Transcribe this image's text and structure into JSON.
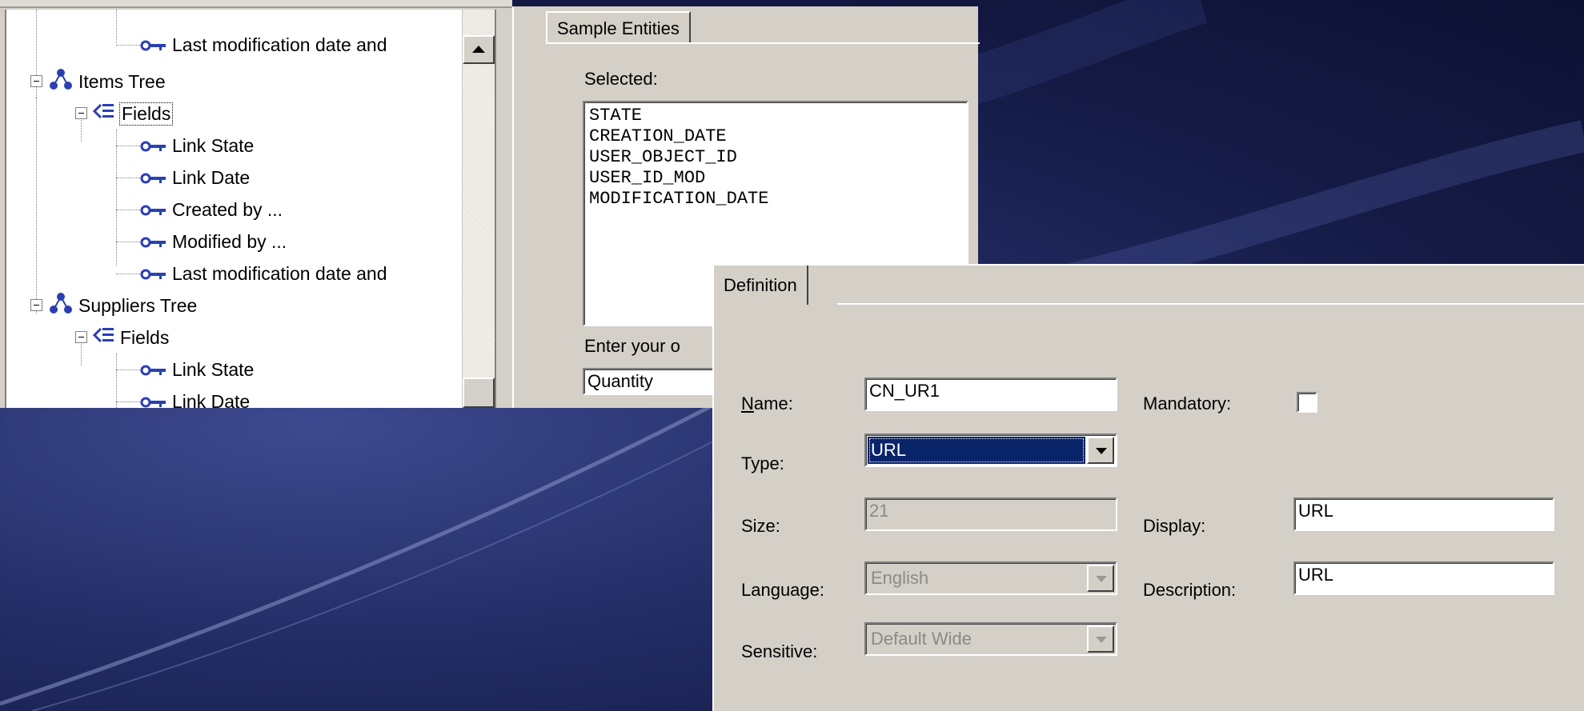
{
  "tree": {
    "rows": [
      {
        "label": "Last modification date and",
        "kind": "field"
      },
      {
        "label": "Items Tree",
        "kind": "tree"
      },
      {
        "label": "Fields",
        "kind": "fields",
        "selected": true
      },
      {
        "label": "Link State",
        "kind": "field"
      },
      {
        "label": "Link Date",
        "kind": "field"
      },
      {
        "label": "Created by ...",
        "kind": "field"
      },
      {
        "label": "Modified by ...",
        "kind": "field"
      },
      {
        "label": "Last modification date and",
        "kind": "field"
      },
      {
        "label": "Suppliers Tree",
        "kind": "tree"
      },
      {
        "label": "Fields",
        "kind": "fields"
      },
      {
        "label": "Link State",
        "kind": "field"
      },
      {
        "label": "Link Date",
        "kind": "field"
      }
    ]
  },
  "sample": {
    "tab_label": "Sample Entities",
    "selected_label": "Selected:",
    "selected_items": [
      "STATE",
      "CREATION_DATE",
      "USER_OBJECT_ID",
      "USER_ID_MOD",
      "MODIFICATION_DATE"
    ],
    "order_label": "Enter your o",
    "order_value": "Quantity"
  },
  "definition": {
    "tab_label": "Definition",
    "name_label_mnemonic": "N",
    "name_label_rest": "ame:",
    "name_value": "CN_UR1",
    "mandatory_label": "Mandatory:",
    "mandatory_checked": false,
    "type_label": "Type:",
    "type_value": "URL",
    "size_label": "Size:",
    "size_value": "21",
    "display_label": "Display:",
    "display_value": "URL",
    "language_label": "Language:",
    "language_value": "English",
    "description_label": "Description:",
    "description_value": "URL",
    "sensitive_label": "Sensitive:",
    "sensitive_value": "Default Wide"
  },
  "colors": {
    "dialog_bg": "#d4d0c8",
    "selection": "#0a246a",
    "background_deep": "#141a44"
  }
}
